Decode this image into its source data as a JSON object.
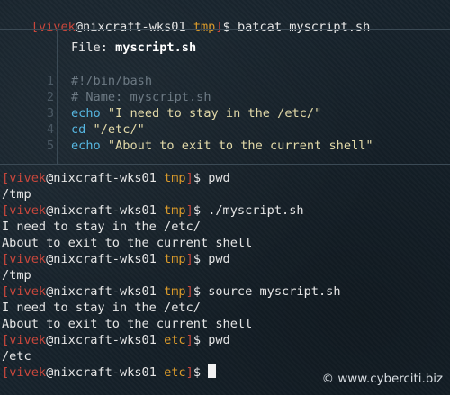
{
  "prompt": {
    "user": "vivek",
    "at": "@",
    "host": "nixcraft-wks01",
    "open_bracket": "[",
    "close_bracket": "]",
    "dollar": "$"
  },
  "batcat": {
    "command": "batcat myscript.sh",
    "file_label": "File: ",
    "file_name": "myscript.sh",
    "line_numbers": [
      "1",
      "2",
      "3",
      "4",
      "5"
    ],
    "lines": [
      {
        "kw": "",
        "text": "#!/bin/bash",
        "type": "comment"
      },
      {
        "kw": "",
        "text": "# Name: myscript.sh",
        "type": "comment"
      },
      {
        "kw": "echo",
        "text": " \"I need to stay in the /etc/\"",
        "type": "cmd"
      },
      {
        "kw": "cd",
        "text": " \"/etc/\"",
        "type": "cmd"
      },
      {
        "kw": "echo",
        "text": " \"About to exit to the current shell\"",
        "type": "cmd"
      }
    ]
  },
  "session": [
    {
      "kind": "prompt",
      "dir": "tmp",
      "cmd": "pwd"
    },
    {
      "kind": "output",
      "text": "/tmp"
    },
    {
      "kind": "prompt",
      "dir": "tmp",
      "cmd": "./myscript.sh"
    },
    {
      "kind": "output",
      "text": "I need to stay in the /etc/"
    },
    {
      "kind": "output",
      "text": "About to exit to the current shell"
    },
    {
      "kind": "prompt",
      "dir": "tmp",
      "cmd": "pwd"
    },
    {
      "kind": "output",
      "text": "/tmp"
    },
    {
      "kind": "prompt",
      "dir": "tmp",
      "cmd": "source myscript.sh"
    },
    {
      "kind": "output",
      "text": "I need to stay in the /etc/"
    },
    {
      "kind": "output",
      "text": "About to exit to the current shell"
    },
    {
      "kind": "prompt",
      "dir": "etc",
      "cmd": "pwd"
    },
    {
      "kind": "output",
      "text": "/etc"
    },
    {
      "kind": "prompt",
      "dir": "etc",
      "cmd": ""
    }
  ],
  "first_dir": "tmp",
  "watermark": "© www.cyberciti.biz"
}
